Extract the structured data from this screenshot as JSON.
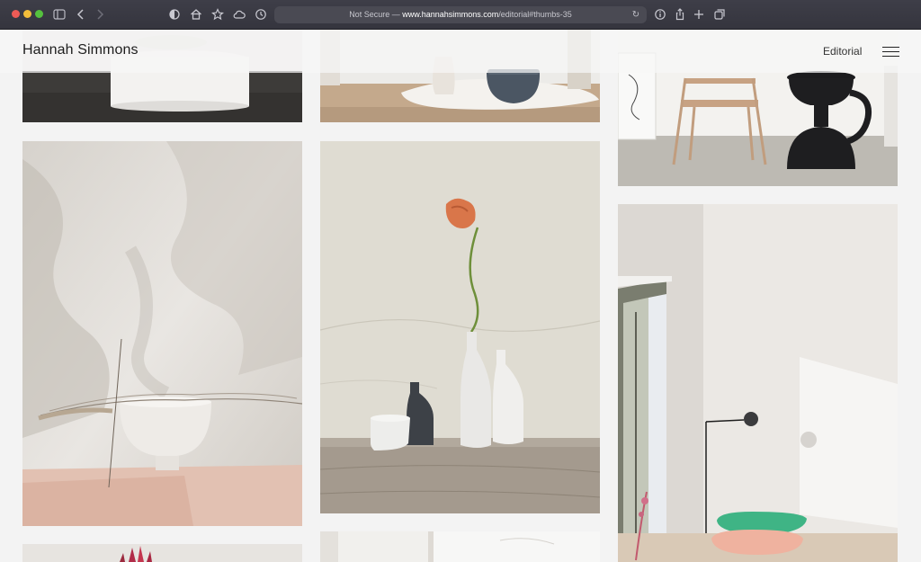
{
  "browser": {
    "address": {
      "prefix": "Not Secure — ",
      "host": "www.hannahsimmons.com",
      "path": "/editorial#thumbs-35"
    },
    "icons": [
      "sidebar-icon",
      "back-icon",
      "forward-icon",
      "privacy-shield-icon",
      "home-icon",
      "bookmark-star-icon",
      "icloud-icon",
      "history-clock-icon",
      "reload-icon",
      "info-icon",
      "share-icon",
      "new-tab-icon",
      "tab-overview-icon"
    ]
  },
  "site": {
    "title": "Hannah Simmons",
    "nav": {
      "editorial": "Editorial"
    }
  },
  "gallery": {
    "thumbnails": [
      {
        "name": "thumb-white-plinth"
      },
      {
        "name": "thumb-ceramics-on-paper"
      },
      {
        "name": "thumb-chair-black-side-table"
      },
      {
        "name": "thumb-shadow-bowl-dried-grass"
      },
      {
        "name": "thumb-vases-orange-flower"
      },
      {
        "name": "thumb-bright-room-cushions"
      },
      {
        "name": "thumb-red-flowers"
      },
      {
        "name": "thumb-window-shelf"
      }
    ]
  },
  "colors": {
    "toolbar": "#3a3a43",
    "page_background": "#f3f3f3",
    "text": "#1d1d1d"
  }
}
